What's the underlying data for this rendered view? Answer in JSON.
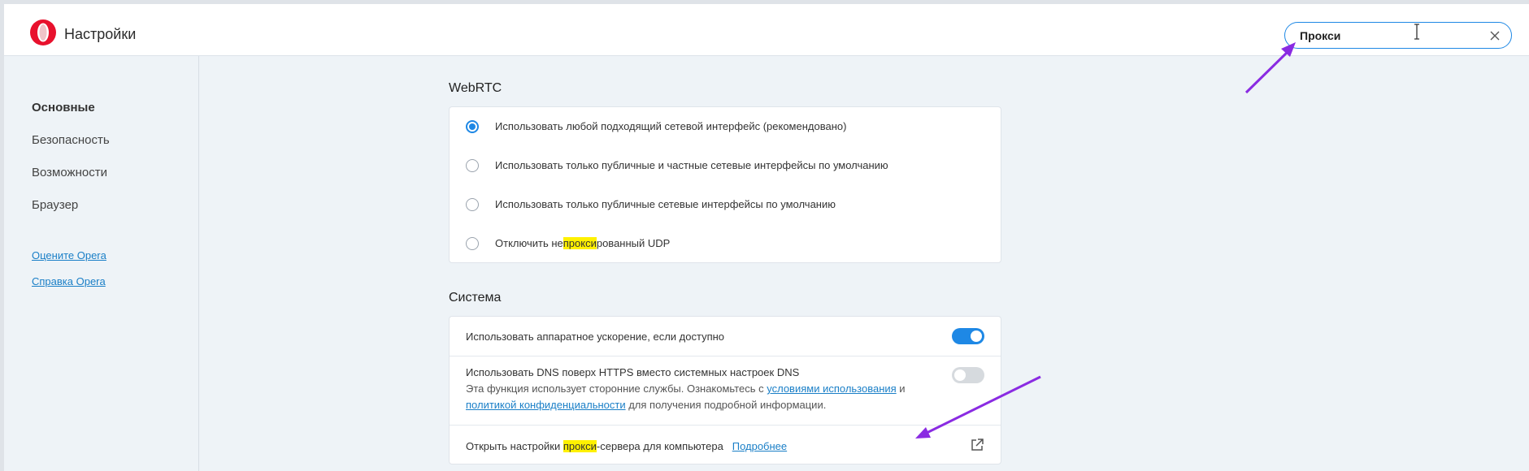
{
  "app": {
    "title": "Настройки"
  },
  "search": {
    "value": "Прокси"
  },
  "sidebar": {
    "items": [
      {
        "label": "Основные",
        "active": true
      },
      {
        "label": "Безопасность",
        "active": false
      },
      {
        "label": "Возможности",
        "active": false
      },
      {
        "label": "Браузер",
        "active": false
      }
    ],
    "links": [
      {
        "label": "Оцените Opera"
      },
      {
        "label": "Справка Opera"
      }
    ]
  },
  "webrtc": {
    "title": "WebRTC",
    "options": [
      {
        "label": "Использовать любой подходящий сетевой интерфейс (рекомендовано)",
        "checked": true
      },
      {
        "label": "Использовать только публичные и частные сетевые интерфейсы по умолчанию",
        "checked": false
      },
      {
        "label": "Использовать только публичные сетевые интерфейсы по умолчанию",
        "checked": false
      },
      {
        "label_before": "Отключить не",
        "label_highlight": "прокси",
        "label_after": "рованный UDP",
        "checked": false
      }
    ]
  },
  "system": {
    "title": "Система",
    "hw_accel": {
      "label": "Использовать аппаратное ускорение, если доступно",
      "enabled": true
    },
    "dns": {
      "label": "Использовать DNS поверх HTTPS вместо системных настроек DNS",
      "enabled": false,
      "desc_1": "Эта функция использует сторонние службы. Ознакомьтесь с ",
      "desc_link_1": "условиями использования",
      "desc_2": " и",
      "desc_link_2": "политикой конфиденциальности",
      "desc_3": " для получения подробной информации."
    },
    "proxy": {
      "label_before": "Открыть настройки ",
      "label_highlight": "прокси",
      "label_after": "-сервера для компьютера",
      "more_link": "Подробнее"
    }
  },
  "colors": {
    "accent": "#1e88e5",
    "highlight": "#fff100",
    "annotation_arrow": "#8a2be2",
    "brand_red": "#e8112d"
  }
}
